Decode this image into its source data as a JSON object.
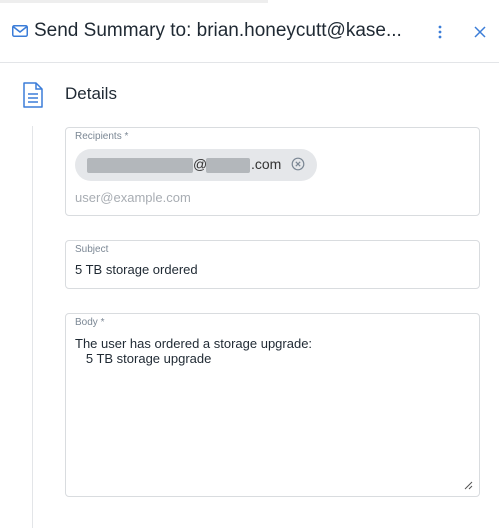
{
  "header": {
    "title": "Send Summary to: brian.honeycutt@kase...",
    "icons": {
      "leading": "mail-icon",
      "menu": "more-vertical-icon",
      "close": "close-icon"
    },
    "accent_color": "#3b7dd8"
  },
  "section": {
    "title": "Details",
    "icon": "document-icon"
  },
  "recipients": {
    "label": "Recipients *",
    "chip": {
      "at": "@",
      "domain_suffix": ".com",
      "remove_icon": "remove-circle-icon"
    },
    "placeholder": "user@example.com"
  },
  "subject": {
    "label": "Subject",
    "value": "5 TB storage ordered"
  },
  "body": {
    "label": "Body *",
    "value": "The user has ordered a storage upgrade:\n   5 TB storage upgrade"
  }
}
